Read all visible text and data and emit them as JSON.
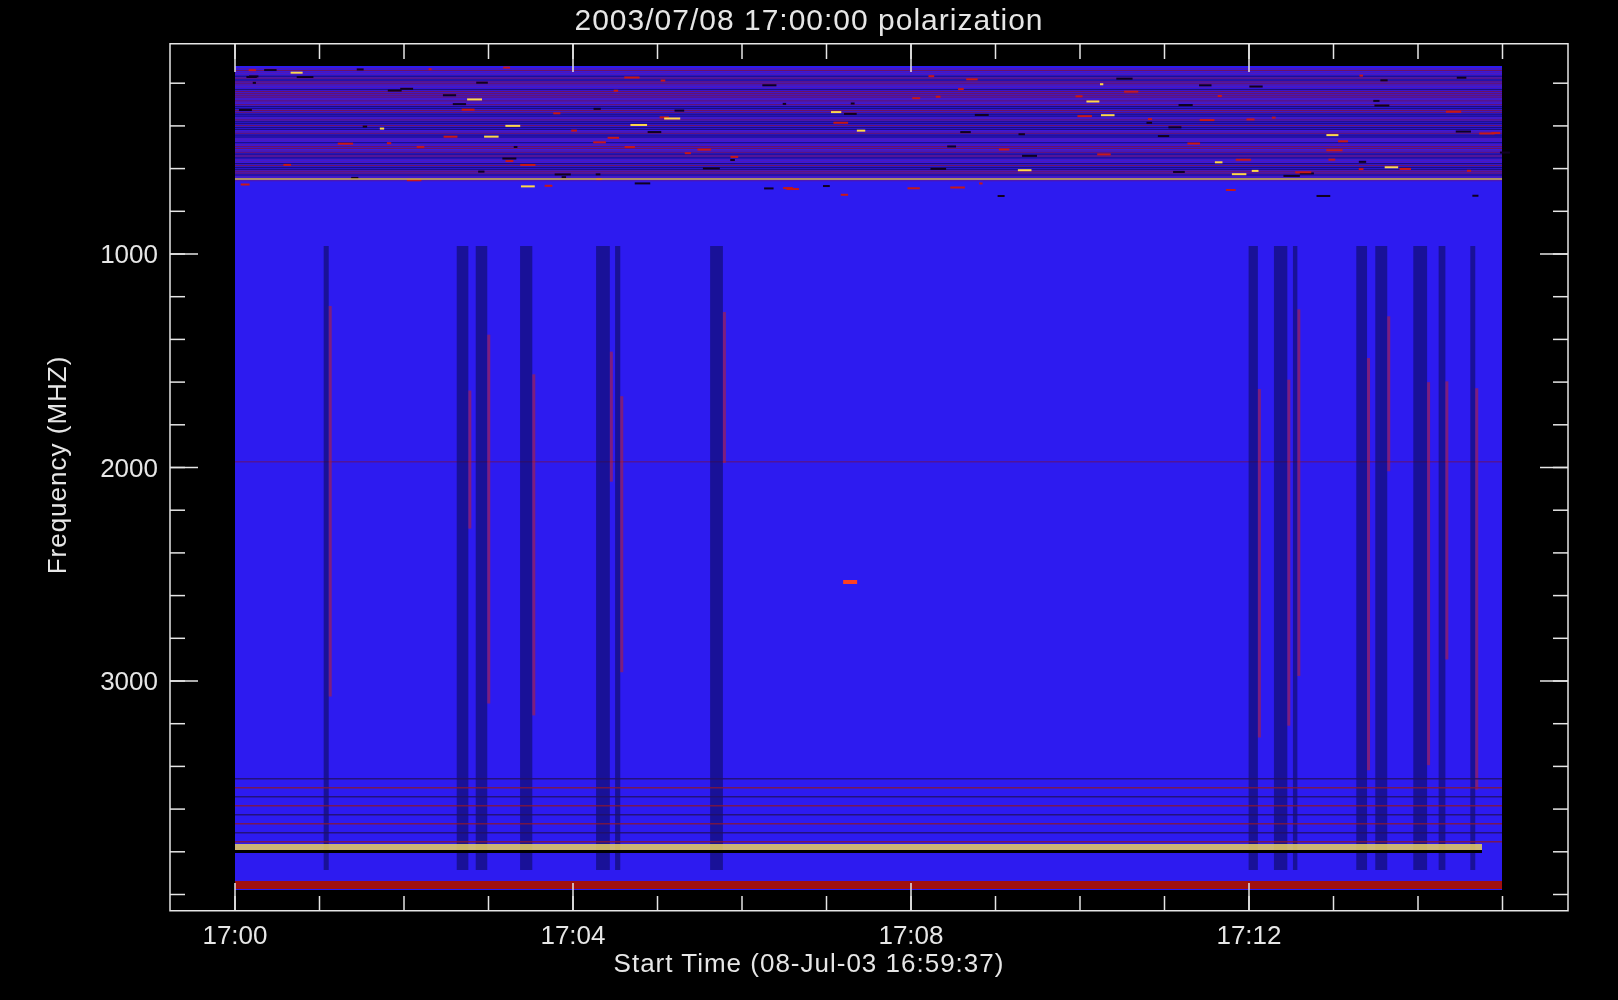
{
  "title": "2003/07/08 17:00:00 polarization",
  "x_axis": {
    "label": "Start Time (08-Jul-03 16:59:37)",
    "ticks": [
      "17:00",
      "17:04",
      "17:08",
      "17:12"
    ]
  },
  "y_axis": {
    "label": "Frequency (MHZ)",
    "ticks": [
      "1000",
      "2000",
      "3000"
    ]
  }
}
